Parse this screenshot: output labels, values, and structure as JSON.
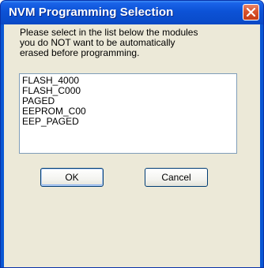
{
  "window": {
    "title": "NVM Programming Selection",
    "close_icon": "close-icon"
  },
  "dialog": {
    "instructions": [
      "Please select in the list below the modules",
      "you do NOT want to be automatically",
      "erased before programming."
    ],
    "modules": [
      "FLASH_4000",
      "FLASH_C000",
      "PAGED",
      "EEPROM_C00",
      "EEP_PAGED"
    ],
    "ok_label": "OK",
    "cancel_label": "Cancel"
  },
  "colors": {
    "titlebar": "#0a4ccb",
    "close_button": "#d9532c",
    "dialog_background": "#ece9d8",
    "list_border": "#7f9db9"
  }
}
